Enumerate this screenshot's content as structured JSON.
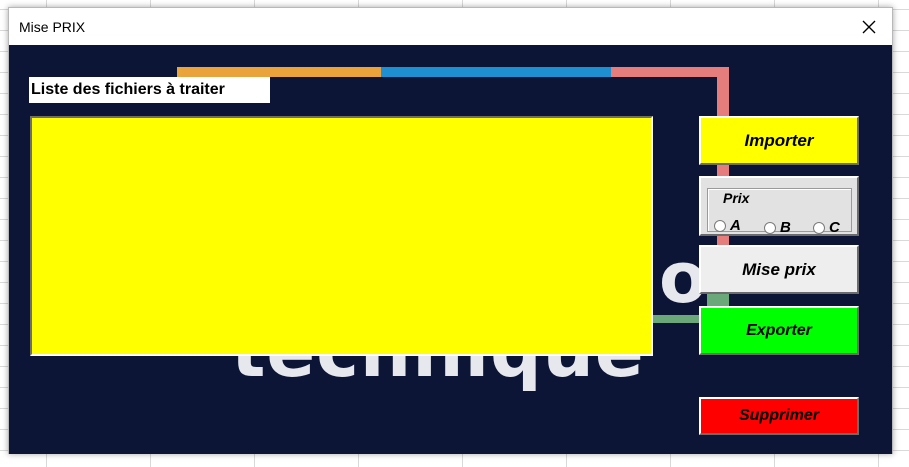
{
  "window": {
    "title": "Mise PRIX",
    "close_icon": "close-icon"
  },
  "list": {
    "label": "Liste des fichiers à traiter",
    "background_color": "#ffff00",
    "items": []
  },
  "buttons": {
    "import_label": "Importer",
    "mise_prix_label": "Mise prix",
    "export_label": "Exporter",
    "delete_label": "Supprimer"
  },
  "prix_group": {
    "legend": "Prix",
    "options": [
      "A",
      "B",
      "C"
    ],
    "selected": null
  },
  "colors": {
    "client_background": "#0c1536",
    "import": "#ffff00",
    "mise_prix": "#eeeeee",
    "export": "#00ff00",
    "delete": "#ff0000"
  }
}
